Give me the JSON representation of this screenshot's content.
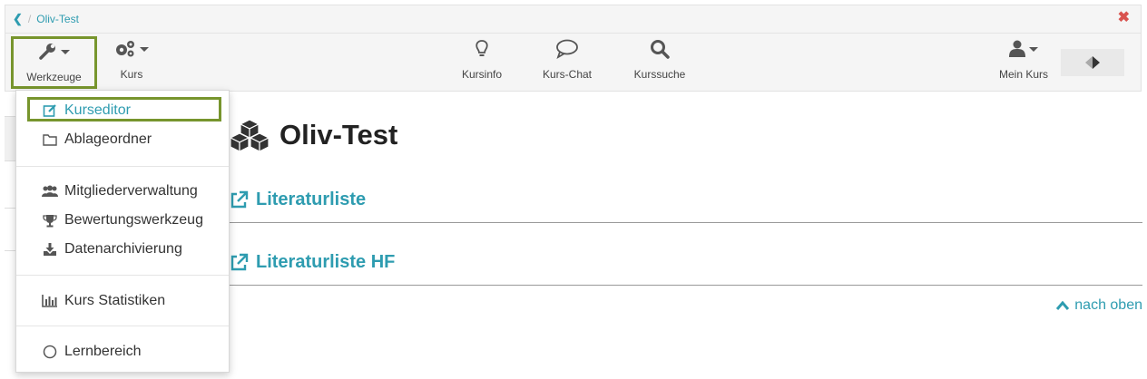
{
  "breadcrumb": {
    "back_icon": "chevron-left-icon",
    "course": "Oliv-Test"
  },
  "toolbar": {
    "tools_label": "Werkzeuge",
    "course_label": "Kurs",
    "courseinfo_label": "Kursinfo",
    "chat_label": "Kurs-Chat",
    "search_label": "Kurssuche",
    "mycourse_label": "Mein Kurs"
  },
  "dropdown": {
    "items": [
      {
        "label": "Kurseditor",
        "icon": "edit-icon"
      },
      {
        "label": "Ablageordner",
        "icon": "folder-icon"
      },
      {
        "label": "Mitgliederverwaltung",
        "icon": "users-icon"
      },
      {
        "label": "Bewertungswerkzeug",
        "icon": "trophy-icon"
      },
      {
        "label": "Datenarchivierung",
        "icon": "download-icon"
      },
      {
        "label": "Kurs Statistiken",
        "icon": "bar-chart-icon"
      },
      {
        "label": "Lernbereich",
        "icon": "circle-icon"
      }
    ]
  },
  "main": {
    "title": "Oliv-Test",
    "links": [
      "Literaturliste",
      "Literaturliste HF"
    ],
    "to_top": "nach oben"
  },
  "colors": {
    "accent": "#2e9cb0",
    "highlight": "#77952d",
    "close": "#d9534f"
  }
}
